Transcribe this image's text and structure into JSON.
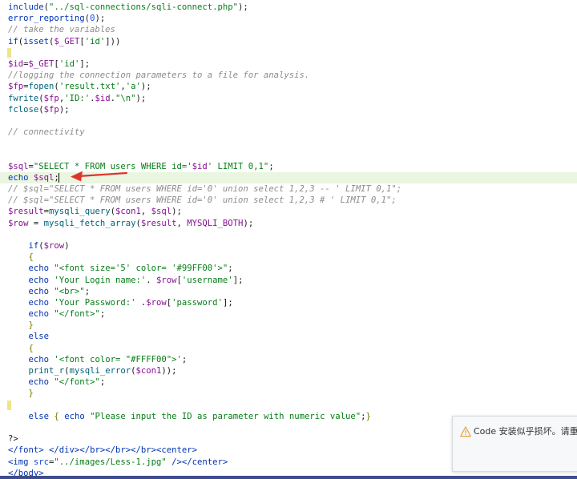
{
  "editor": {
    "lines": [
      [
        [
          "fn",
          "include"
        ],
        [
          "txt",
          "("
        ],
        [
          "str",
          "\"../sql-connections/sqli-connect.php\""
        ],
        [
          "txt",
          ");"
        ]
      ],
      [
        [
          "fn",
          "error_reporting"
        ],
        [
          "txt",
          "("
        ],
        [
          "num",
          "0"
        ],
        [
          "txt",
          ");"
        ]
      ],
      [
        [
          "com",
          "// take the variables"
        ]
      ],
      [
        [
          "kw",
          "if"
        ],
        [
          "txt",
          "("
        ],
        [
          "fn",
          "isset"
        ],
        [
          "txt",
          "("
        ],
        [
          "var",
          "$_GET"
        ],
        [
          "txt",
          "["
        ],
        [
          "str",
          "'id'"
        ],
        [
          "txt",
          "]))"
        ]
      ],
      [
        [
          "marker",
          ""
        ]
      ],
      [
        [
          "var",
          "$id"
        ],
        [
          "txt",
          "="
        ],
        [
          "var",
          "$_GET"
        ],
        [
          "txt",
          "["
        ],
        [
          "str",
          "'id'"
        ],
        [
          "txt",
          "];"
        ]
      ],
      [
        [
          "com",
          "//logging the connection parameters to a file for analysis."
        ]
      ],
      [
        [
          "var",
          "$fp"
        ],
        [
          "txt",
          "="
        ],
        [
          "fnc",
          "fopen"
        ],
        [
          "txt",
          "("
        ],
        [
          "str",
          "'result.txt'"
        ],
        [
          "txt",
          ","
        ],
        [
          "str",
          "'a'"
        ],
        [
          "txt",
          ");"
        ]
      ],
      [
        [
          "fnc",
          "fwrite"
        ],
        [
          "txt",
          "("
        ],
        [
          "var",
          "$fp"
        ],
        [
          "txt",
          ","
        ],
        [
          "str",
          "'ID:'"
        ],
        [
          "txt",
          "."
        ],
        [
          "var",
          "$id"
        ],
        [
          "txt",
          "."
        ],
        [
          "str",
          "\"\\n\""
        ],
        [
          "txt",
          ");"
        ]
      ],
      [
        [
          "fnc",
          "fclose"
        ],
        [
          "txt",
          "("
        ],
        [
          "var",
          "$fp"
        ],
        [
          "txt",
          ");"
        ]
      ],
      [],
      [
        [
          "com",
          "// connectivity"
        ]
      ],
      [],
      [],
      [
        [
          "var",
          "$sql"
        ],
        [
          "txt",
          "="
        ],
        [
          "str",
          "\"SELECT * FROM users WHERE id='"
        ],
        [
          "var",
          "$id"
        ],
        [
          "str",
          "' LIMIT 0,1\""
        ],
        [
          "txt",
          ";"
        ]
      ],
      [
        [
          "kw",
          "echo"
        ],
        [
          "txt",
          " "
        ],
        [
          "var",
          "$sql"
        ],
        [
          "txt",
          ";"
        ]
      ],
      [
        [
          "com",
          "// $sql=\"SELECT * FROM users WHERE id='0' union select 1,2,3 -- ' LIMIT 0,1\";"
        ]
      ],
      [
        [
          "com",
          "// $sql=\"SELECT * FROM users WHERE id='0' union select 1,2,3 # ' LIMIT 0,1\";"
        ]
      ],
      [
        [
          "var",
          "$result"
        ],
        [
          "txt",
          "="
        ],
        [
          "fnc",
          "mysqli_query"
        ],
        [
          "txt",
          "("
        ],
        [
          "var",
          "$con1"
        ],
        [
          "txt",
          ", "
        ],
        [
          "var",
          "$sql"
        ],
        [
          "txt",
          ");"
        ]
      ],
      [
        [
          "var",
          "$row"
        ],
        [
          "txt",
          " = "
        ],
        [
          "fnc",
          "mysqli_fetch_array"
        ],
        [
          "txt",
          "("
        ],
        [
          "var",
          "$result"
        ],
        [
          "txt",
          ", "
        ],
        [
          "var",
          "MYSQLI_BOTH"
        ],
        [
          "txt",
          ");"
        ]
      ],
      [],
      [
        [
          "txt",
          "    "
        ],
        [
          "kw",
          "if"
        ],
        [
          "txt",
          "("
        ],
        [
          "var",
          "$row"
        ],
        [
          "txt",
          ")"
        ]
      ],
      [
        [
          "txt",
          "    "
        ],
        [
          "br",
          "{"
        ]
      ],
      [
        [
          "txt",
          "    "
        ],
        [
          "kw",
          "echo"
        ],
        [
          "txt",
          " "
        ],
        [
          "str",
          "\"<font size='5' color= '#99FF00'>\""
        ],
        [
          "txt",
          ";"
        ]
      ],
      [
        [
          "txt",
          "    "
        ],
        [
          "kw",
          "echo"
        ],
        [
          "txt",
          " "
        ],
        [
          "str",
          "'Your Login name:'"
        ],
        [
          "txt",
          ". "
        ],
        [
          "var",
          "$row"
        ],
        [
          "txt",
          "["
        ],
        [
          "str",
          "'username'"
        ],
        [
          "txt",
          "];"
        ]
      ],
      [
        [
          "txt",
          "    "
        ],
        [
          "kw",
          "echo"
        ],
        [
          "txt",
          " "
        ],
        [
          "str",
          "\"<br>\""
        ],
        [
          "txt",
          ";"
        ]
      ],
      [
        [
          "txt",
          "    "
        ],
        [
          "kw",
          "echo"
        ],
        [
          "txt",
          " "
        ],
        [
          "str",
          "'Your Password:'"
        ],
        [
          "txt",
          " ."
        ],
        [
          "var",
          "$row"
        ],
        [
          "txt",
          "["
        ],
        [
          "str",
          "'password'"
        ],
        [
          "txt",
          "];"
        ]
      ],
      [
        [
          "txt",
          "    "
        ],
        [
          "kw",
          "echo"
        ],
        [
          "txt",
          " "
        ],
        [
          "str",
          "\"</font>\""
        ],
        [
          "txt",
          ";"
        ]
      ],
      [
        [
          "txt",
          "    "
        ],
        [
          "br",
          "}"
        ]
      ],
      [
        [
          "txt",
          "    "
        ],
        [
          "kw",
          "else"
        ]
      ],
      [
        [
          "txt",
          "    "
        ],
        [
          "br",
          "{"
        ]
      ],
      [
        [
          "txt",
          "    "
        ],
        [
          "kw",
          "echo"
        ],
        [
          "txt",
          " "
        ],
        [
          "str",
          "'<font color= \"#FFFF00\">'"
        ],
        [
          "txt",
          ";"
        ]
      ],
      [
        [
          "txt",
          "    "
        ],
        [
          "fnc",
          "print_r"
        ],
        [
          "txt",
          "("
        ],
        [
          "fnc",
          "mysqli_error"
        ],
        [
          "txt",
          "("
        ],
        [
          "var",
          "$con1"
        ],
        [
          "txt",
          "));"
        ]
      ],
      [
        [
          "txt",
          "    "
        ],
        [
          "kw",
          "echo"
        ],
        [
          "txt",
          " "
        ],
        [
          "str",
          "\"</font>\""
        ],
        [
          "txt",
          ";"
        ]
      ],
      [
        [
          "txt",
          "    "
        ],
        [
          "br",
          "}"
        ]
      ],
      [
        [
          "marker",
          ""
        ]
      ],
      [
        [
          "txt",
          "    "
        ],
        [
          "kw",
          "else"
        ],
        [
          "txt",
          " "
        ],
        [
          "br",
          "{"
        ],
        [
          "txt",
          " "
        ],
        [
          "kw",
          "echo"
        ],
        [
          "txt",
          " "
        ],
        [
          "str",
          "\"Please input the ID as parameter with numeric value\""
        ],
        [
          "txt",
          ";"
        ],
        [
          "br",
          "}"
        ]
      ],
      [],
      [
        [
          "txt",
          "?>"
        ]
      ],
      [
        [
          "tag",
          "</font>"
        ],
        [
          "txt",
          " "
        ],
        [
          "tag",
          "</div>"
        ],
        [
          "tag",
          "</br>"
        ],
        [
          "tag",
          "</br>"
        ],
        [
          "tag",
          "</br>"
        ],
        [
          "tag",
          "<center>"
        ]
      ],
      [
        [
          "tag",
          "<img "
        ],
        [
          "attr",
          "src"
        ],
        [
          "txt",
          "="
        ],
        [
          "aval",
          "\"../images/Less-1.jpg\""
        ],
        [
          "txt",
          " "
        ],
        [
          "tag",
          "/>"
        ],
        [
          "tag",
          "</center>"
        ]
      ],
      [
        [
          "tag",
          "</body>"
        ]
      ]
    ],
    "current_line": 15
  },
  "notification": {
    "message": "Code 安装似乎损坏。请重新安装。",
    "icon": "warning-icon",
    "icon_color": "#e6a23c"
  },
  "colors": {
    "arrow": "#e0342a",
    "current_line_bg": "#eaf6e0"
  }
}
